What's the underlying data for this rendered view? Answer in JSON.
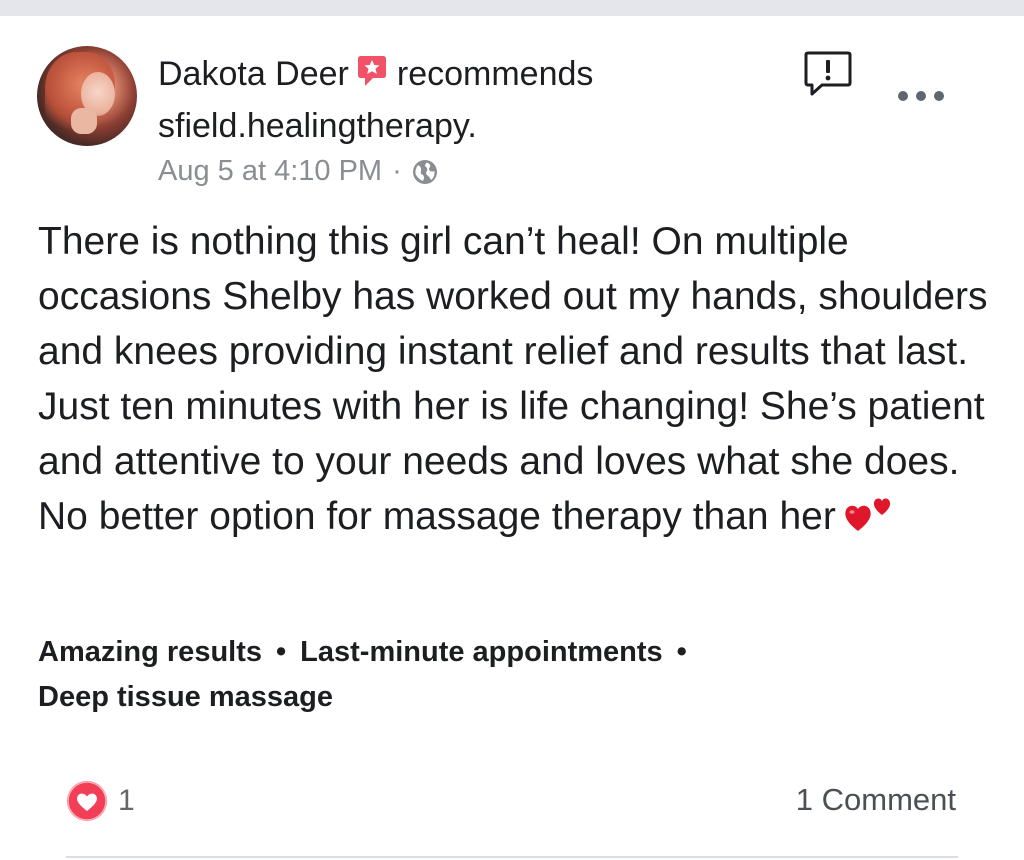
{
  "post": {
    "author": "Dakota Deer",
    "action": "recommends",
    "page_name": "sfield.healingtherapy.",
    "timestamp": "Aug 5 at 4:10 PM",
    "separator": "·",
    "audience_icon": "globe-icon",
    "body": "There is nothing this girl can’t heal! On multiple occasions Shelby has worked out my hands, shoulders and knees providing instant relief and results that last. Just ten minutes with her is life changing! She’s patient and attentive to your needs and loves what she does. No better option for massage therapy than her",
    "tags": [
      "Amazing results",
      "Last-minute appointments",
      "Deep tissue massage"
    ],
    "tag_separator": "•",
    "reactions": {
      "icon": "love-reaction-icon",
      "count": "1"
    },
    "comments_label": "1 Comment"
  },
  "icons": {
    "recommend": "recommend-badge-icon",
    "report": "report-icon",
    "more": "more-options-icon",
    "emoji": "two-hearts-emoji"
  },
  "colors": {
    "recommend_badge": "#f25268",
    "love_reaction": "#f33e58",
    "meta_text": "#8a8d91",
    "heart_emoji": "#e0162b"
  }
}
